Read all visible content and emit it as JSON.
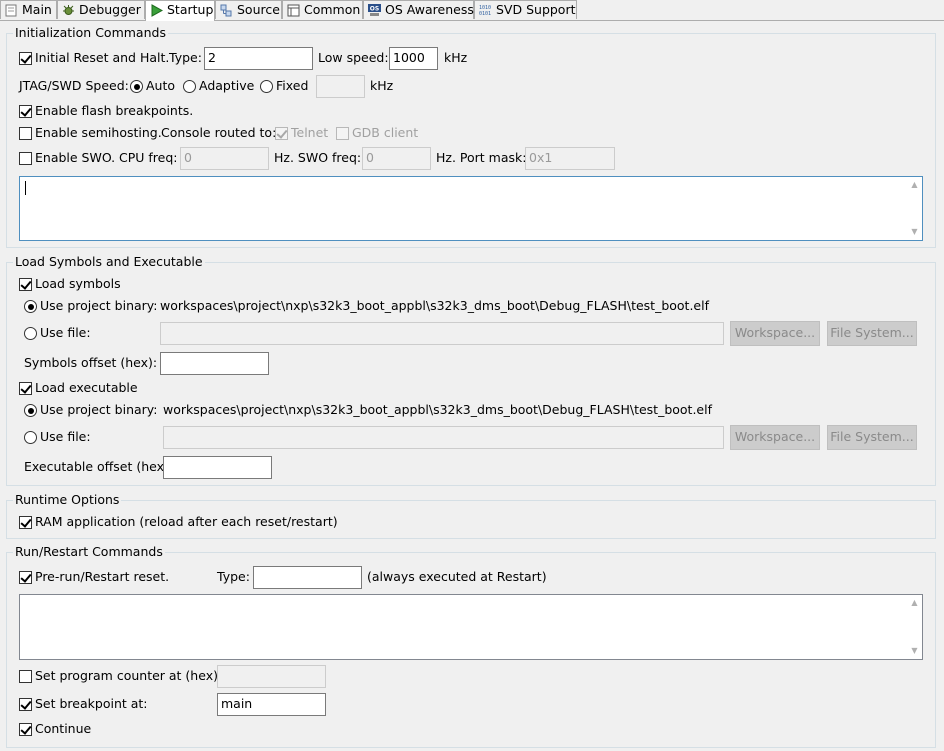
{
  "tabs": [
    {
      "label": "Main",
      "icon": "main-icon"
    },
    {
      "label": "Debugger",
      "icon": "debugger-icon"
    },
    {
      "label": "Startup",
      "icon": "startup-icon"
    },
    {
      "label": "Source",
      "icon": "source-icon"
    },
    {
      "label": "Common",
      "icon": "common-icon"
    },
    {
      "label": "OS Awareness",
      "icon": "os-awareness-icon"
    },
    {
      "label": "SVD Support",
      "icon": "svd-icon"
    }
  ],
  "active_tab": "Startup",
  "init": {
    "title": "Initialization Commands",
    "reset_label": "Initial Reset and Halt.",
    "reset_checked": true,
    "type_label": "Type:",
    "type_value": "2",
    "low_speed_label": "Low speed:",
    "low_speed_value": "1000",
    "khz": "kHz",
    "jtag_label": "JTAG/SWD Speed:",
    "auto_label": "Auto",
    "adaptive_label": "Adaptive",
    "fixed_label": "Fixed",
    "fixed_value": "",
    "selected_speed": "Auto",
    "flash_bp_label": "Enable flash breakpoints.",
    "flash_bp_checked": true,
    "semihosting_label": "Enable semihosting.",
    "semihosting_checked": false,
    "console_label": "Console routed to:",
    "telnet_label": "Telnet",
    "telnet_checked": true,
    "gdb_label": "GDB client",
    "gdb_checked": false,
    "swo_label": "Enable SWO.",
    "swo_checked": false,
    "cpu_freq_label": "CPU freq:",
    "cpu_freq_value": "0",
    "hz_swo_label": "Hz. SWO freq:",
    "swo_freq_value": "0",
    "hz_mask_label": "Hz. Port mask:",
    "port_mask_value": "0x1",
    "commands_text": ""
  },
  "load": {
    "title": "Load Symbols and Executable",
    "load_symbols_label": "Load symbols",
    "load_symbols_checked": true,
    "use_project_binary_label": "Use project binary:",
    "symbols_project_path": "workspaces\\project\\nxp\\s32k3_boot_appbl\\s32k3_dms_boot\\Debug_FLASH\\test_boot.elf",
    "use_file_label": "Use file:",
    "workspace_button": "Workspace...",
    "file_system_button": "File System...",
    "symbols_offset_label": "Symbols offset (hex):",
    "symbols_offset_value": "",
    "load_executable_label": "Load executable",
    "load_executable_checked": true,
    "executable_project_path": "workspaces\\project\\nxp\\s32k3_boot_appbl\\s32k3_dms_boot\\Debug_FLASH\\test_boot.elf",
    "executable_offset_label": "Executable offset (hex):",
    "executable_offset_value": ""
  },
  "runtime": {
    "title": "Runtime Options",
    "ram_app_label": "RAM application (reload after each reset/restart)",
    "ram_app_checked": true
  },
  "run": {
    "title": "Run/Restart Commands",
    "prerun_label": "Pre-run/Restart reset.",
    "prerun_checked": true,
    "type_label": "Type:",
    "type_value": "",
    "always_note": "(always executed at Restart)",
    "commands_text": "",
    "set_pc_label": "Set program counter at (hex):",
    "set_pc_checked": false,
    "set_pc_value": "",
    "set_bp_label": "Set breakpoint at:",
    "set_bp_checked": true,
    "set_bp_value": "main",
    "continue_label": "Continue",
    "continue_checked": true
  }
}
